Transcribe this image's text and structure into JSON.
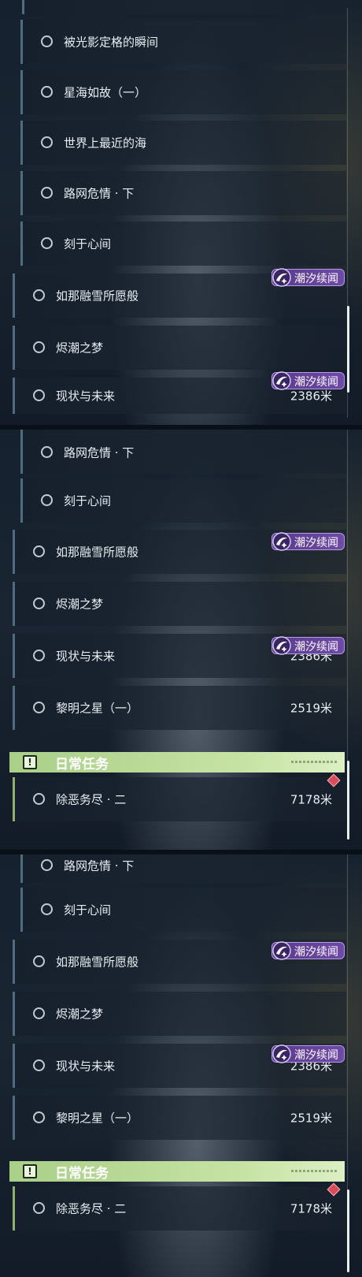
{
  "tag_label": "潮汐续闻",
  "daily_header_title": "日常任务",
  "daily_header_mark": "!",
  "panel1": {
    "items": [
      {
        "label": "被光影定格的瞬间"
      },
      {
        "label": "星海如故（一）"
      },
      {
        "label": "世界上最近的海"
      },
      {
        "label": "路网危情 · 下"
      },
      {
        "label": "刻于心间"
      },
      {
        "label": "如那融雪所愿般"
      },
      {
        "label": "烬潮之梦"
      },
      {
        "label": "现状与未来",
        "distance": "2386米"
      }
    ]
  },
  "panel2": {
    "items": [
      {
        "label": "路网危情 · 下"
      },
      {
        "label": "刻于心间"
      },
      {
        "label": "如那融雪所愿般"
      },
      {
        "label": "烬潮之梦"
      },
      {
        "label": "现状与未来",
        "distance": "2386米"
      },
      {
        "label": "黎明之星（一）",
        "distance": "2519米"
      }
    ],
    "daily": {
      "label": "除恶务尽 · 二",
      "distance": "7178米"
    }
  },
  "panel3": {
    "items": [
      {
        "label": "路网危情 · 下"
      },
      {
        "label": "刻于心间"
      },
      {
        "label": "如那融雪所愿般"
      },
      {
        "label": "烬潮之梦"
      },
      {
        "label": "现状与未来",
        "distance": "2386米"
      },
      {
        "label": "黎明之星（一）",
        "distance": "2519米"
      }
    ],
    "daily": {
      "label": "除恶务尽 · 二",
      "distance": "7178米"
    }
  },
  "colors": {
    "tag_purple": "#6e4aa8",
    "daily_green": "#a9cf88",
    "marker_red": "#d94a5a"
  },
  "icons": {
    "quest_status": "circle-outline-icon",
    "tag": "tide-swirl-icon",
    "daily": "exclamation-icon",
    "marker": "diamond-marker-icon"
  }
}
